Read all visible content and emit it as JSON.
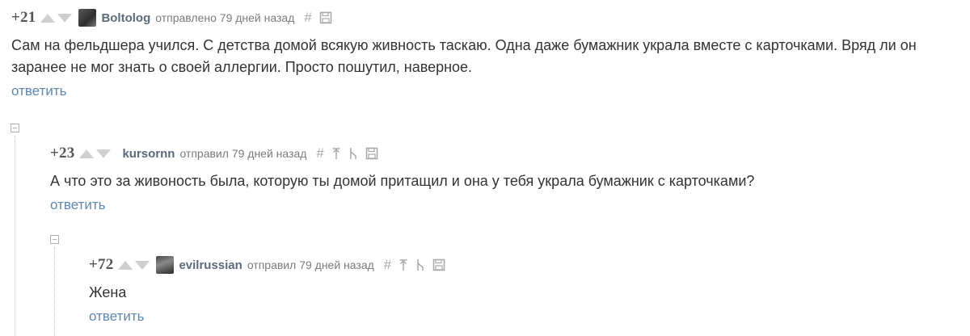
{
  "comments": [
    {
      "rating": "+21",
      "username": "Boltolog",
      "meta": "отправлено 79 дней назад",
      "text": "Сам на фельдшера учился. С детства домой всякую живность таскаю. Одна даже бумажник украла вместе с карточками. Вряд ли он заранее не мог знать о своей аллергии. Просто пошутил, наверное.",
      "reply": "ответить"
    },
    {
      "rating": "+23",
      "username": "kursornn",
      "meta": "отправил 79 дней назад",
      "text": "А что это за живоность была, которую ты домой притащил и она у тебя украла бумажник с карточками?",
      "reply": "ответить"
    },
    {
      "rating": "+72",
      "username": "evilrussian",
      "meta": "отправил 79 дней назад",
      "text": "Жена",
      "reply": "ответить"
    }
  ],
  "icons": {
    "link": "hash-icon",
    "parent": "arrow-up-icon",
    "branch": "branch-icon",
    "save": "save-icon"
  },
  "colors": {
    "username": "#5b6a7c",
    "reply_link": "#5f87ad",
    "meta": "#7a7a7a",
    "vote_arrows": "#cfcfcf"
  }
}
